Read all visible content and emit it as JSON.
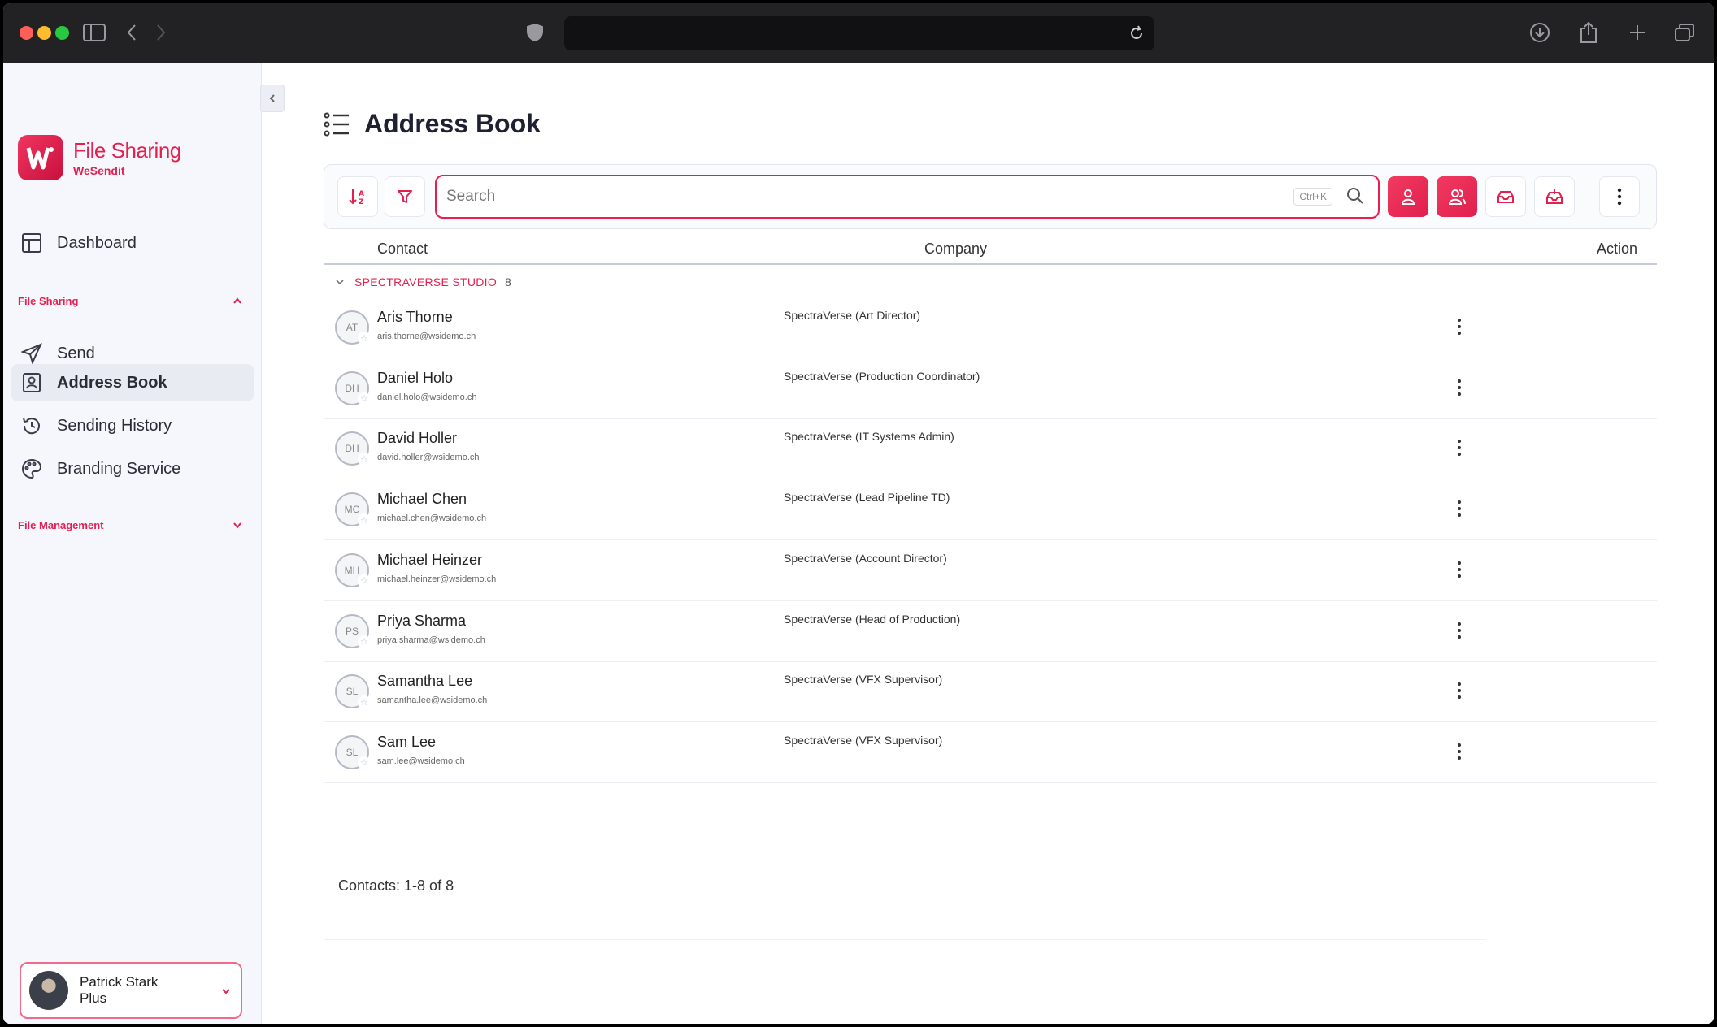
{
  "browser": {
    "colors": {
      "close": "#ff5f57",
      "minimize": "#febc2e",
      "maximize": "#28c840"
    },
    "icons": [
      "sidebar-toggle-icon",
      "back-icon",
      "forward-icon",
      "shield-icon",
      "reload-icon",
      "download-icon",
      "share-icon",
      "new-tab-icon",
      "tabs-icon"
    ]
  },
  "brand": {
    "title": "File Sharing",
    "subtitle": "WeSendit",
    "accent": "#e5204e"
  },
  "sidebar": {
    "dashboard_label": "Dashboard",
    "file_sharing_heading": "File Sharing",
    "items": [
      {
        "label": "Send",
        "icon": "send-icon"
      },
      {
        "label": "Address Book",
        "icon": "address-book-icon",
        "active": true
      },
      {
        "label": "Sending History",
        "icon": "history-icon"
      },
      {
        "label": "Branding Service",
        "icon": "palette-icon"
      }
    ],
    "file_management_heading": "File Management",
    "user": {
      "name": "Patrick Stark",
      "plan": "Plus"
    }
  },
  "main": {
    "title": "Address Book",
    "search": {
      "placeholder": "Search",
      "shortcut": "Ctrl+K"
    },
    "columns": {
      "contact": "Contact",
      "company": "Company",
      "action": "Action"
    },
    "group": {
      "name": "SPECTRAVERSE STUDIO",
      "count": "8"
    },
    "contacts": [
      {
        "initials": "AT",
        "name": "Aris Thorne",
        "email": "aris.thorne@wsidemo.ch",
        "company": "SpectraVerse (Art Director)"
      },
      {
        "initials": "DH",
        "name": "Daniel Holo",
        "email": "daniel.holo@wsidemo.ch",
        "company": "SpectraVerse (Production Coordinator)"
      },
      {
        "initials": "DH",
        "name": "David Holler",
        "email": "david.holler@wsidemo.ch",
        "company": "SpectraVerse (IT Systems Admin)"
      },
      {
        "initials": "MC",
        "name": "Michael Chen",
        "email": "michael.chen@wsidemo.ch",
        "company": "SpectraVerse (Lead Pipeline TD)"
      },
      {
        "initials": "MH",
        "name": "Michael Heinzer",
        "email": "michael.heinzer@wsidemo.ch",
        "company": "SpectraVerse (Account Director)"
      },
      {
        "initials": "PS",
        "name": "Priya Sharma",
        "email": "priya.sharma@wsidemo.ch",
        "company": "SpectraVerse (Head of Production)"
      },
      {
        "initials": "SL",
        "name": "Samantha Lee",
        "email": "samantha.lee@wsidemo.ch",
        "company": "SpectraVerse (VFX Supervisor)"
      },
      {
        "initials": "SL",
        "name": "Sam Lee",
        "email": "sam.lee@wsidemo.ch",
        "company": "SpectraVerse (VFX Supervisor)"
      }
    ],
    "footer_count": "Contacts: 1-8 of 8"
  }
}
